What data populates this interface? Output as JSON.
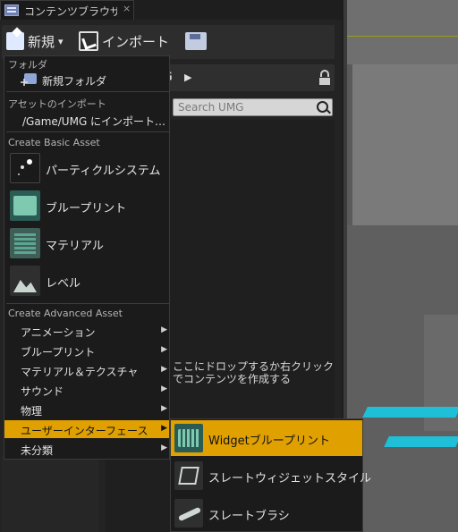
{
  "tab": {
    "title": "コンテンツブラウザ",
    "close": "×"
  },
  "toolbar": {
    "new_label": "新規",
    "new_caret": "▾",
    "import_label": "インポート"
  },
  "path": {
    "current": "G",
    "arrow": "▶"
  },
  "search": {
    "placeholder": "Search UMG"
  },
  "empty_hint": "ここにドロップするか右クリックでコンテンツを作成する",
  "menu": {
    "folder_header": "フォルダ",
    "new_folder": "新規フォルダ",
    "import_header": "アセットのインポート",
    "import_to": "/Game/UMG にインポート…",
    "basic_header": "Create Basic Asset",
    "basic_items": [
      {
        "label": "パーティクルシステム",
        "icon": "particle-system-icon"
      },
      {
        "label": "ブループリント",
        "icon": "blueprint-icon"
      },
      {
        "label": "マテリアル",
        "icon": "material-icon"
      },
      {
        "label": "レベル",
        "icon": "level-icon"
      }
    ],
    "advanced_header": "Create Advanced Asset",
    "advanced_items": [
      {
        "label": "アニメーション"
      },
      {
        "label": "ブループリント"
      },
      {
        "label": "マテリアル＆テクスチャ"
      },
      {
        "label": "サウンド"
      },
      {
        "label": "物理"
      },
      {
        "label": "ユーザーインターフェース",
        "selected": true
      },
      {
        "label": "未分類"
      }
    ],
    "submenu_arrow": "▶"
  },
  "submenu": {
    "items": [
      {
        "label": "Widgetブループリント",
        "icon": "widget-blueprint-icon",
        "selected": true
      },
      {
        "label": "スレートウィジェットスタイル",
        "icon": "slate-widget-style-icon"
      },
      {
        "label": "スレートブラシ",
        "icon": "slate-brush-icon"
      }
    ]
  },
  "colors": {
    "highlight": "#e0a000",
    "menu_bg": "#1b1b1b",
    "panel_bg": "#232323"
  }
}
